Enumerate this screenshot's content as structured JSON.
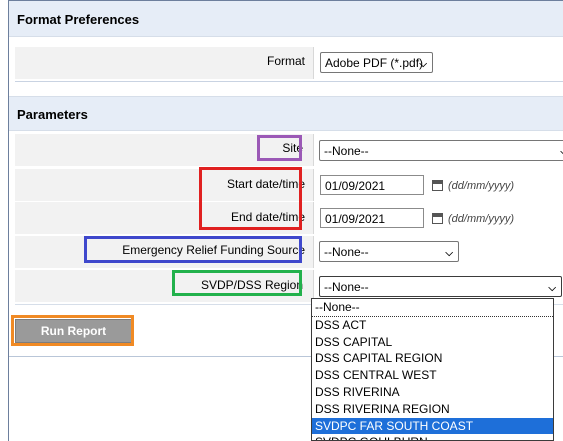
{
  "format_section": {
    "title": "Format Preferences",
    "format_label": "Format",
    "format_value": "Adobe PDF (*.pdf)"
  },
  "params_section": {
    "title": "Parameters",
    "site_label": "Site",
    "site_value": "--None--",
    "start_label": "Start date/time",
    "start_value": "01/09/2021",
    "end_label": "End date/time",
    "end_value": "01/09/2021",
    "date_hint": "(dd/mm/yyyy)",
    "funding_label": "Emergency Relief Funding Source",
    "funding_value": "--None--",
    "region_label": "SVDP/DSS Region",
    "region_value": "--None--",
    "region_options": [
      "--None--",
      "DSS ACT",
      "DSS CAPITAL",
      "DSS CAPITAL REGION",
      "DSS CENTRAL WEST",
      "DSS RIVERINA",
      "DSS RIVERINA REGION",
      "SVDPC FAR SOUTH COAST",
      "SVDPC GOULBURN"
    ],
    "region_selected_index": 7
  },
  "run_button": "Run Report",
  "colors": {
    "band": "#e6edf7",
    "site_highlight": "#9b59b6",
    "date_highlight": "#e02020",
    "funding_highlight": "#3f48cc",
    "region_highlight": "#22b14c",
    "run_highlight": "#f08a24",
    "option_selected": "#1e6fd9"
  },
  "icons": [
    "calendar-icon",
    "chevron-down-icon"
  ]
}
